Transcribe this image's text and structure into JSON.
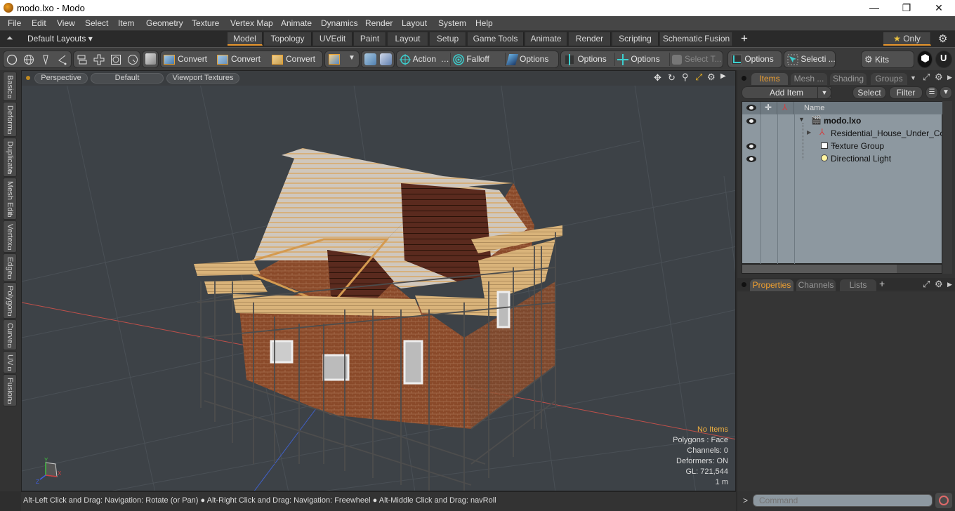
{
  "window": {
    "title": "modo.lxo - Modo",
    "minimize": "—",
    "maximize": "❐",
    "close": "✕"
  },
  "menu": [
    "File",
    "Edit",
    "View",
    "Select",
    "Item",
    "Geometry",
    "Texture",
    "Vertex Map",
    "Animate",
    "Dynamics",
    "Render",
    "Layout",
    "System",
    "Help"
  ],
  "layouts": {
    "dropdown": "Default Layouts ▾",
    "tabs": [
      "Model",
      "Topology",
      "UVEdit",
      "Paint",
      "Layout",
      "Setup",
      "Game Tools",
      "Animate",
      "Render",
      "Scripting",
      "Schematic Fusion"
    ],
    "active": "Model",
    "add": "+",
    "only": "Only",
    "star": "★"
  },
  "toolbar": {
    "convert1": "Convert",
    "convert2": "Convert",
    "convert3": "Convert",
    "action": "Action",
    "action_more": "…",
    "falloff": "Falloff",
    "options1": "Options",
    "options2": "Options",
    "options3": "Options",
    "options4": "Options",
    "select_t": "Select T...",
    "selecti": "Selecti ...",
    "kits": "Kits"
  },
  "sidetabs": [
    "Basic",
    "Deform",
    "Duplicate",
    "Mesh Edit",
    "Vertex",
    "Edge",
    "Polygon",
    "Curve",
    "UV",
    "Fusion"
  ],
  "viewport": {
    "view": "Perspective",
    "shading": "Default",
    "textures": "Viewport Textures",
    "hud": {
      "selection": "No Items",
      "polygons": "Polygons : Face",
      "channels": "Channels: 0",
      "deformers": "Deformers: ON",
      "gl": "GL: 721,544",
      "scale": "1 m"
    },
    "axes": {
      "x": "X",
      "y": "Y",
      "z": "Z"
    }
  },
  "itemspanel": {
    "tabs": [
      "Items",
      "Mesh ...",
      "Shading",
      "Groups"
    ],
    "active": "Items",
    "add_item": "Add Item",
    "select": "Select",
    "filter": "Filter",
    "column_name": "Name",
    "rows": [
      {
        "name": "modo.lxo",
        "visible": true
      },
      {
        "name": "Residential_House_Under_Co ...",
        "visible": false
      },
      {
        "name": "Texture Group",
        "visible": true
      },
      {
        "name": "Directional Light",
        "visible": true
      }
    ]
  },
  "propspanel": {
    "tabs": [
      "Properties",
      "Channels",
      "Lists"
    ],
    "active": "Properties",
    "add": "+"
  },
  "status": {
    "hint1": "Alt-Left Click and Drag: Navigation: Rotate (or Pan)",
    "hint2": "Alt-Right Click and Drag: Navigation: Freewheel",
    "hint3": "Alt-Middle Click and Drag: navRoll"
  },
  "command": {
    "prompt": ">",
    "placeholder": "Command"
  },
  "colors": {
    "accent": "#e8952c",
    "active_tab_text": "#f0a030"
  }
}
